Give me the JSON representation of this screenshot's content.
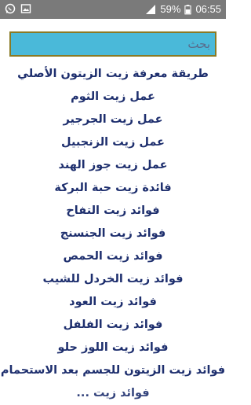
{
  "status_bar": {
    "left_icons": [
      "whatsapp-icon",
      "image-icon"
    ],
    "battery_percent": "59%",
    "time": "06:55"
  },
  "search": {
    "placeholder": "بحث",
    "value": ""
  },
  "colors": {
    "status_bar": "#7a7a7a",
    "search_background": "#4ab9d9",
    "search_border": "#8a7a25",
    "list_text": "#1e2f6e"
  },
  "list": {
    "items": [
      "طريقة معرفة زيت الزيتون الأصلي",
      "عمل زيت الثوم",
      "عمل زيت الجرجير",
      "عمل زيت الزنجبيل",
      "عمل زيت جوز الهند",
      "فائدة زيت حبة البركة",
      "فوائد زيت التفاح",
      "فوائد زيت الجنسنج",
      "فوائد زيت الحمص",
      "فوائد زيت الخردل للشيب",
      "فوائد زيت العود",
      "فوائد زيت الفلفل",
      "فوائد زيت اللوز حلو",
      "فوائد زيت الزيتون للجسم بعد الاستحمام",
      "فوائد زيت ..."
    ]
  }
}
